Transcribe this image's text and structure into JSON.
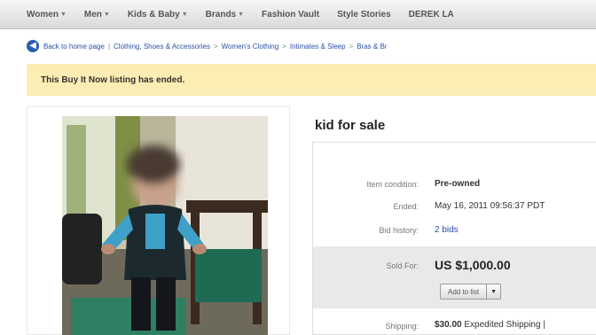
{
  "nav": {
    "items": [
      {
        "label": "Women",
        "dropdown": true
      },
      {
        "label": "Men",
        "dropdown": true
      },
      {
        "label": "Kids & Baby",
        "dropdown": true
      },
      {
        "label": "Brands",
        "dropdown": true
      },
      {
        "label": "Fashion Vault",
        "dropdown": false
      },
      {
        "label": "Style Stories",
        "dropdown": false
      },
      {
        "label": "DEREK LA",
        "dropdown": false
      }
    ]
  },
  "breadcrumb": {
    "back_label": "Back to home page",
    "items": [
      "Clothing, Shoes & Accessories",
      "Women's Clothing",
      "Intimates & Sleep",
      "Bras & Br"
    ]
  },
  "banner": {
    "text": "This Buy It Now listing has ended."
  },
  "listing": {
    "title": "kid for sale",
    "condition_label": "Item condition:",
    "condition_value": "Pre-owned",
    "ended_label": "Ended:",
    "ended_value": "May 16, 2011 09:56:37 PDT",
    "bid_history_label": "Bid history:",
    "bid_history_value": "2 bids",
    "sold_for_label": "Sold For:",
    "sold_for_value": "US $1,000.00",
    "watch_button_label": "Add to list",
    "shipping_label": "Shipping:",
    "shipping_price": "$30.00",
    "shipping_method": "Expedited Shipping"
  },
  "icons": {
    "back": "back-arrow-icon",
    "dropdown": "chevron-down-icon"
  },
  "colors": {
    "banner_bg": "#fbedb3",
    "link": "#2a4fa8",
    "sold_box_bg": "#e9e9e9"
  }
}
